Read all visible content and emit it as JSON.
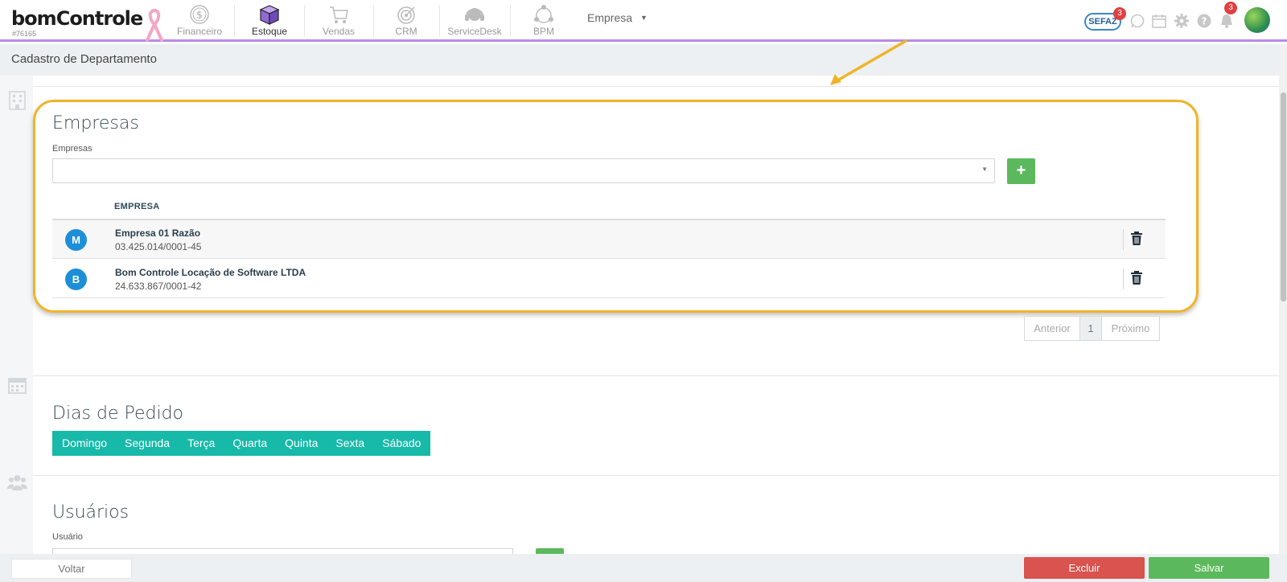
{
  "header": {
    "logo_text": "bomcontrole",
    "logo_id": "#76165",
    "nav": [
      {
        "label": "Financeiro",
        "icon": "dollar-coin-icon"
      },
      {
        "label": "Estoque",
        "icon": "box-icon"
      },
      {
        "label": "Vendas",
        "icon": "shopping-cart-icon"
      },
      {
        "label": "CRM",
        "icon": "target-icon"
      },
      {
        "label": "ServiceDesk",
        "icon": "headset-icon"
      },
      {
        "label": "BPM",
        "icon": "network-icon"
      }
    ],
    "active_nav": "Estoque",
    "company_dropdown": "Empresa",
    "sefaz_label": "SEFAZ",
    "sefaz_badge": "3",
    "notifications_badge": "3"
  },
  "page": {
    "title": "Cadastro de Departamento"
  },
  "empresas": {
    "section_title": "Empresas",
    "field_label": "Empresas",
    "select_value": "",
    "add_label": "+",
    "column_header": "EMPRESA",
    "rows": [
      {
        "initial": "M",
        "name": "Empresa 01 Razão",
        "doc": "03.425.014/0001-45"
      },
      {
        "initial": "B",
        "name": "Bom Controle Locação de Software LTDA",
        "doc": "24.633.867/0001-42"
      }
    ],
    "pagination": {
      "prev": "Anterior",
      "current": "1",
      "next": "Próximo"
    }
  },
  "dias": {
    "section_title": "Dias de Pedido",
    "days": [
      "Domingo",
      "Segunda",
      "Terça",
      "Quarta",
      "Quinta",
      "Sexta",
      "Sábado"
    ]
  },
  "usuarios": {
    "section_title": "Usuários",
    "field_label": "Usuário"
  },
  "footer": {
    "back_label": "Voltar",
    "delete_label": "Excluir",
    "save_label": "Salvar"
  },
  "colors": {
    "accent_purple": "#b98be8",
    "highlight": "#f0b429",
    "success": "#5cb85c",
    "danger": "#d9534f",
    "days_teal": "#17b9a8",
    "avatar_blue": "#1d8fd8"
  }
}
